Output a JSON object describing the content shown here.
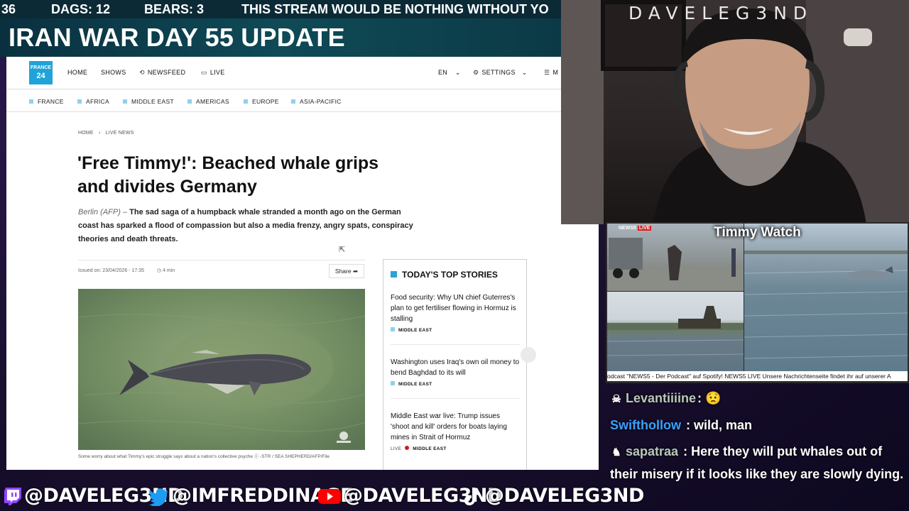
{
  "ticker": {
    "count": "36",
    "dags": "DAGS: 12",
    "bears": "BEARS: 3",
    "message": "THIS STREAM WOULD BE NOTHING WITHOUT YO"
  },
  "banner": {
    "title": "IRAN WAR DAY 55 UPDATE"
  },
  "site": {
    "logo_line1": "FRANCE",
    "logo_line2": "24",
    "nav": {
      "home": "HOME",
      "shows": "SHOWS",
      "newsfeed": "NEWSFEED",
      "live": "LIVE",
      "lang": "EN",
      "settings": "SETTINGS",
      "menu": "M"
    },
    "regions": [
      "FRANCE",
      "AFRICA",
      "MIDDLE EAST",
      "AMERICAS",
      "EUROPE",
      "ASIA-PACIFIC"
    ]
  },
  "article": {
    "breadcrumb_home": "HOME",
    "breadcrumb_section": "LIVE NEWS",
    "title": "'Free Timmy!': Beached whale grips and divides Germany",
    "dateline": "Berlin (AFP) –",
    "lede": "The sad saga of a humpback whale stranded a month ago on the German coast has sparked a flood of compassion but also a media frenzy, angry spats, conspiracy theories and death threats.",
    "issued": "Issued on: 23/04/2026 - 17:35",
    "read_time": "4 min",
    "share": "Share",
    "caption": "Some worry about what Timmy's epic struggle says about a nation's collective psyche ⓒ -STR / SEA SHEPHERD/AFP/File"
  },
  "top_stories": {
    "heading": "TODAY'S TOP STORIES",
    "items": [
      {
        "title": "Food security: Why UN chief Guterres's plan to get fertiliser flowing in Hormuz is stalling",
        "live": "",
        "tag": "MIDDLE EAST"
      },
      {
        "title": "Washington uses Iraq's own oil money to bend Baghdad to its will",
        "live": "",
        "tag": "MIDDLE EAST"
      },
      {
        "title": "Middle East war live: Trump issues 'shoot and kill' orders for boats laying mines in Strait of Hormuz",
        "live": "LIVE",
        "tag": "MIDDLE EAST"
      }
    ]
  },
  "webcam": {
    "name": "DAVELEG3ND"
  },
  "timmy_watch": {
    "title": "Timmy Watch",
    "badge": "NEWS5",
    "badge_live": "LIVE",
    "ticker": "odcast \"NEWS5 - Der Podcast\" auf Spotify!  NEWS5 LIVE  Unsere Nachrichtenseite findet ihr auf unserer A"
  },
  "chat": [
    {
      "user": "Levantiiiine",
      "sep": ":",
      "message": "😟",
      "user_color": "#b9c8bb"
    },
    {
      "user": "Swifthollow",
      "sep": ":",
      "message": "wild, man",
      "user_color": "#3aa0ff"
    },
    {
      "user": "sapatraa",
      "sep": ":",
      "message": "Here they will put whales out of their misery if it looks like they are slowly dying.",
      "user_color": "#b9c8bb"
    }
  ],
  "socials": {
    "twitch": "@DAVELEG3ND",
    "twitter": "@IMFREDDINAGE",
    "youtube": "@DAVELEG3ND",
    "tiktok": "@DAVELEG3ND"
  },
  "colors": {
    "twitch": "#9146ff",
    "twitter": "#1d9bf0",
    "youtube": "#ff0000",
    "france24": "#1fa3d8"
  },
  "icons": [
    "twitch-icon",
    "twitter-icon",
    "youtube-icon",
    "tiktok-icon",
    "history-icon",
    "tv-icon",
    "gear-icon",
    "hamburger-icon",
    "clock-icon",
    "share-icon",
    "chevron-down-icon",
    "skull-icon"
  ]
}
